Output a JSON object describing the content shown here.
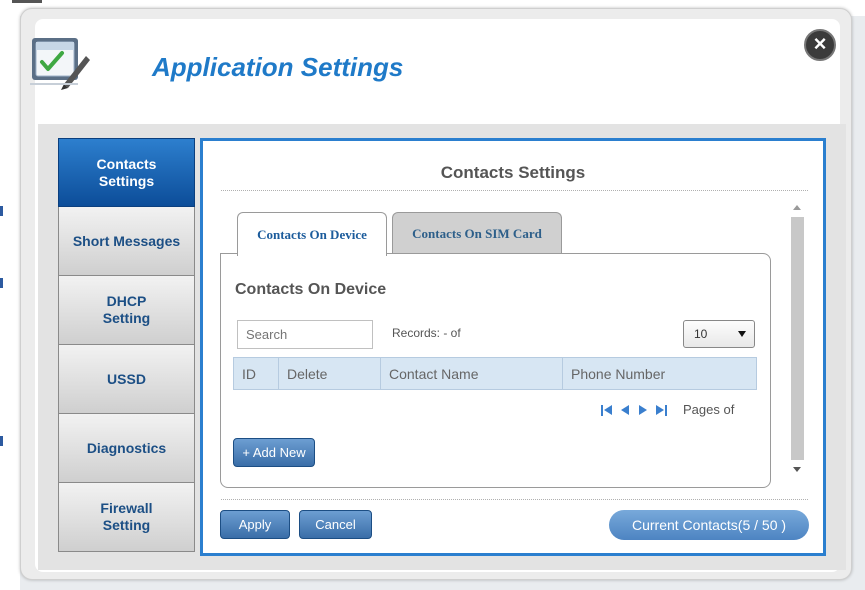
{
  "dialog": {
    "title": "Application Settings",
    "close_icon": "close-x-icon",
    "title_icon": "checklist-pen-icon"
  },
  "sidebar": {
    "items": [
      {
        "label": "Contacts Settings",
        "active": true
      },
      {
        "label": "Short Messages",
        "active": false
      },
      {
        "label": "DHCP Setting",
        "active": false
      },
      {
        "label": "USSD",
        "active": false
      },
      {
        "label": "Diagnostics",
        "active": false
      },
      {
        "label": "Firewall Setting",
        "active": false
      }
    ]
  },
  "panel": {
    "title": "Contacts Settings",
    "tabs": [
      {
        "label": "Contacts On Device",
        "active": true
      },
      {
        "label": "Contacts On SIM Card",
        "active": false
      }
    ],
    "section_heading": "Contacts On Device",
    "search_placeholder": "Search",
    "records_text": "Records: - of",
    "page_size": "10",
    "table": {
      "columns": [
        "ID",
        "Delete",
        "Contact Name",
        "Phone Number"
      ],
      "rows": []
    },
    "pager_text": "Pages of",
    "add_new_label": "+ Add New",
    "apply_label": "Apply",
    "cancel_label": "Cancel",
    "current_contacts_label": "Current Contacts(5 / 50 )"
  },
  "colors": {
    "accent_blue": "#2b7fcf",
    "title_blue": "#1f7ac8",
    "active_nav": "#1460ad",
    "table_header": "#d7e6f3"
  }
}
